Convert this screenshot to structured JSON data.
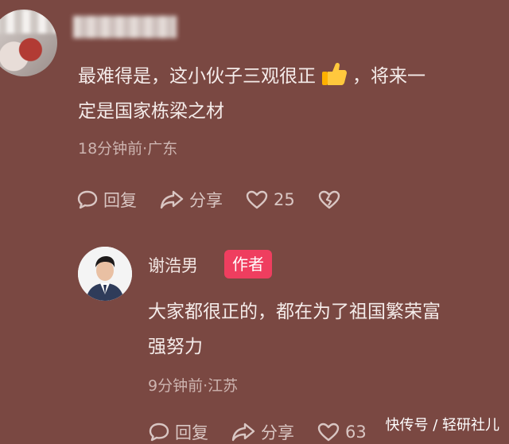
{
  "comment1": {
    "text_part1": "最难得是，这小伙子三观很正",
    "text_part2": "，将来一",
    "text_line2": "定是国家栋梁之材",
    "meta": "18分钟前·广东",
    "actions": {
      "reply": "回复",
      "share": "分享",
      "likes": "25"
    }
  },
  "reply": {
    "author_name": "谢浩男",
    "author_badge": "作者",
    "text_line1": "大家都很正的，都在为了祖国繁荣富",
    "text_line2": "强努力",
    "meta": "9分钟前·江苏",
    "actions": {
      "reply": "回复",
      "share": "分享",
      "likes": "63"
    }
  },
  "watermark": "快传号 / 轻研社儿",
  "icons": [
    "thumbs-up-emoji",
    "reply-icon",
    "share-icon",
    "heart-icon",
    "broken-heart-icon"
  ]
}
